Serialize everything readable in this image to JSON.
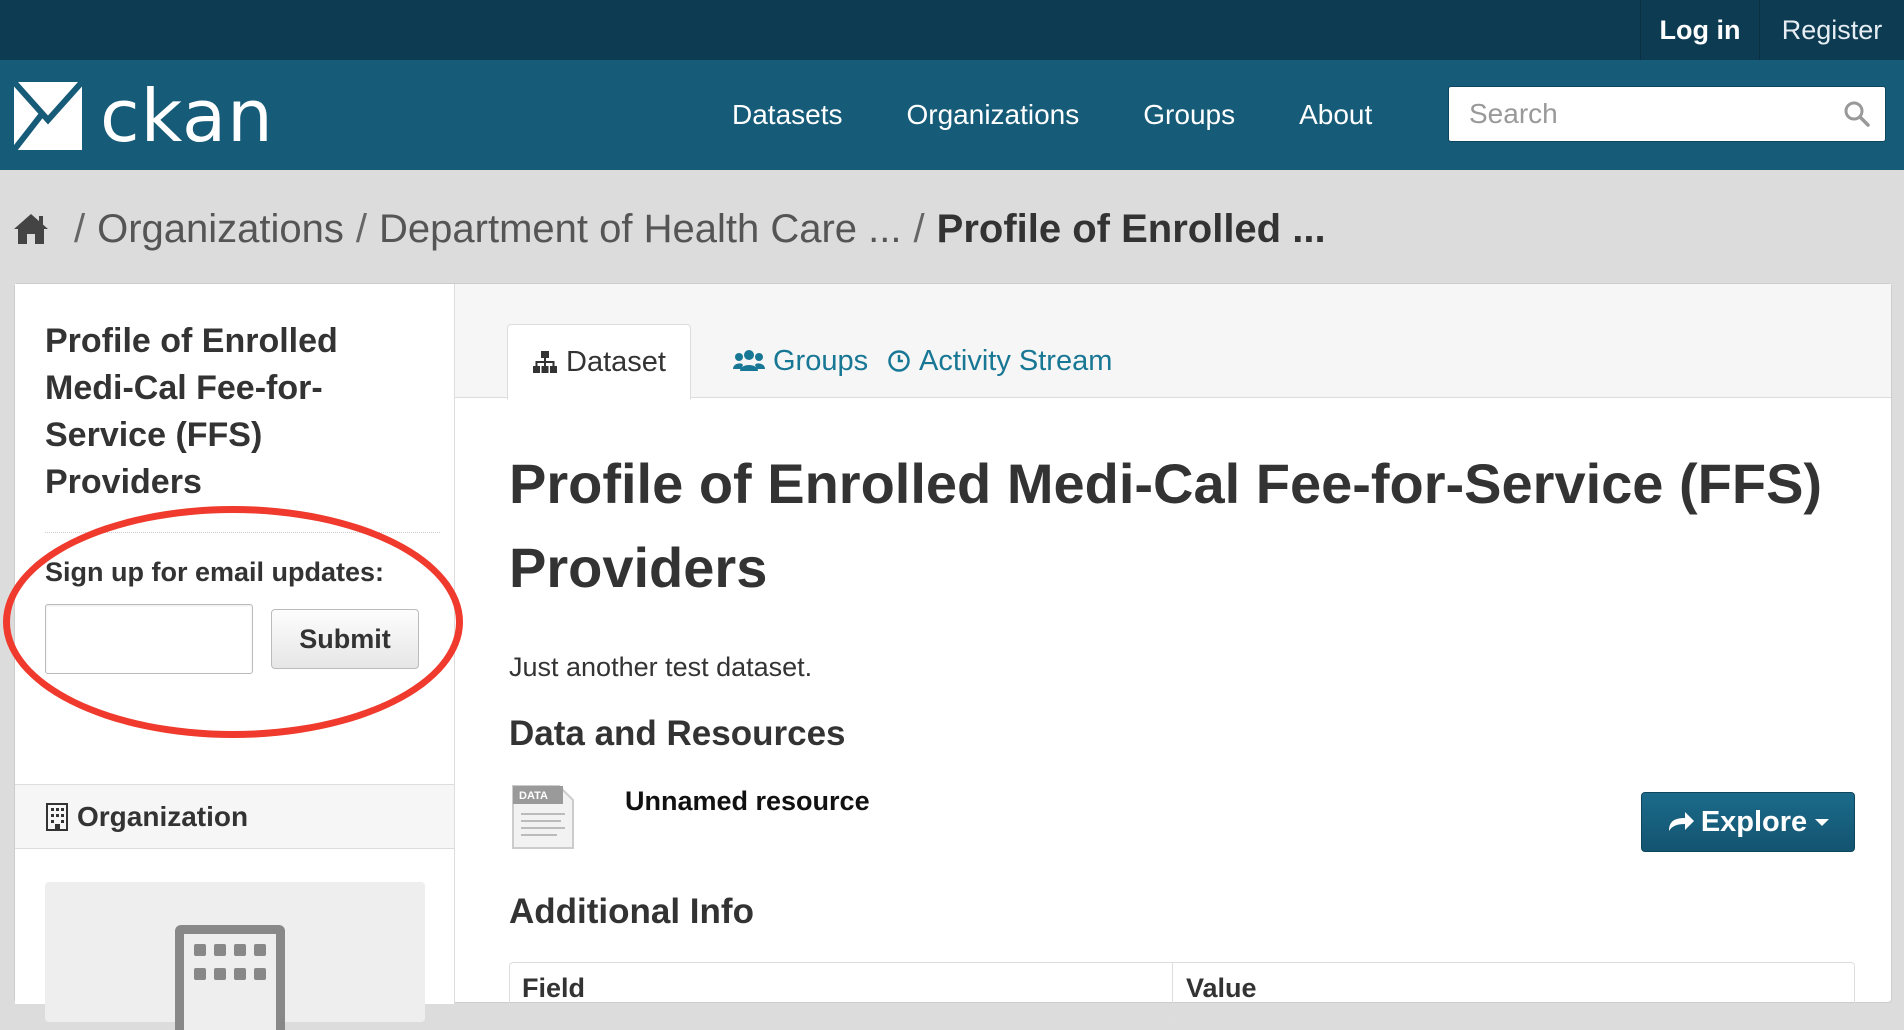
{
  "account": {
    "login": "Log in",
    "register": "Register"
  },
  "brand": {
    "name": "ckan"
  },
  "nav": [
    "Datasets",
    "Organizations",
    "Groups",
    "About"
  ],
  "search": {
    "placeholder": "Search"
  },
  "breadcrumb": {
    "sep": "/",
    "items": [
      "Organizations",
      "Department of Health Care ..."
    ],
    "active": "Profile of Enrolled ..."
  },
  "sidebar": {
    "title": "Profile of Enrolled Medi-Cal Fee-for-Service (FFS) Providers",
    "email_label": "Sign up for email updates:",
    "email_value": "",
    "submit": "Submit",
    "org_heading": "Organization"
  },
  "tabs": [
    "Dataset",
    "Groups",
    "Activity Stream"
  ],
  "dataset": {
    "title": "Profile of Enrolled Medi-Cal Fee-for-Service (FFS) Providers",
    "notes": "Just another test dataset.",
    "resources_heading": "Data and Resources",
    "resource_name": "Unnamed resource",
    "resource_icon_text": "DATA",
    "explore": "Explore",
    "additional_heading": "Additional Info",
    "table_headers": [
      "Field",
      "Value"
    ]
  },
  "colors": {
    "account_bar": "#0d3b52",
    "masthead": "#165b78",
    "link": "#187794",
    "annotation_circle": "#ef3a2d"
  },
  "icons": [
    "ckan-logo-icon",
    "search-icon",
    "home-icon",
    "sitemap-icon",
    "users-icon",
    "clock-icon",
    "share-icon",
    "building-icon",
    "data-file-icon"
  ]
}
